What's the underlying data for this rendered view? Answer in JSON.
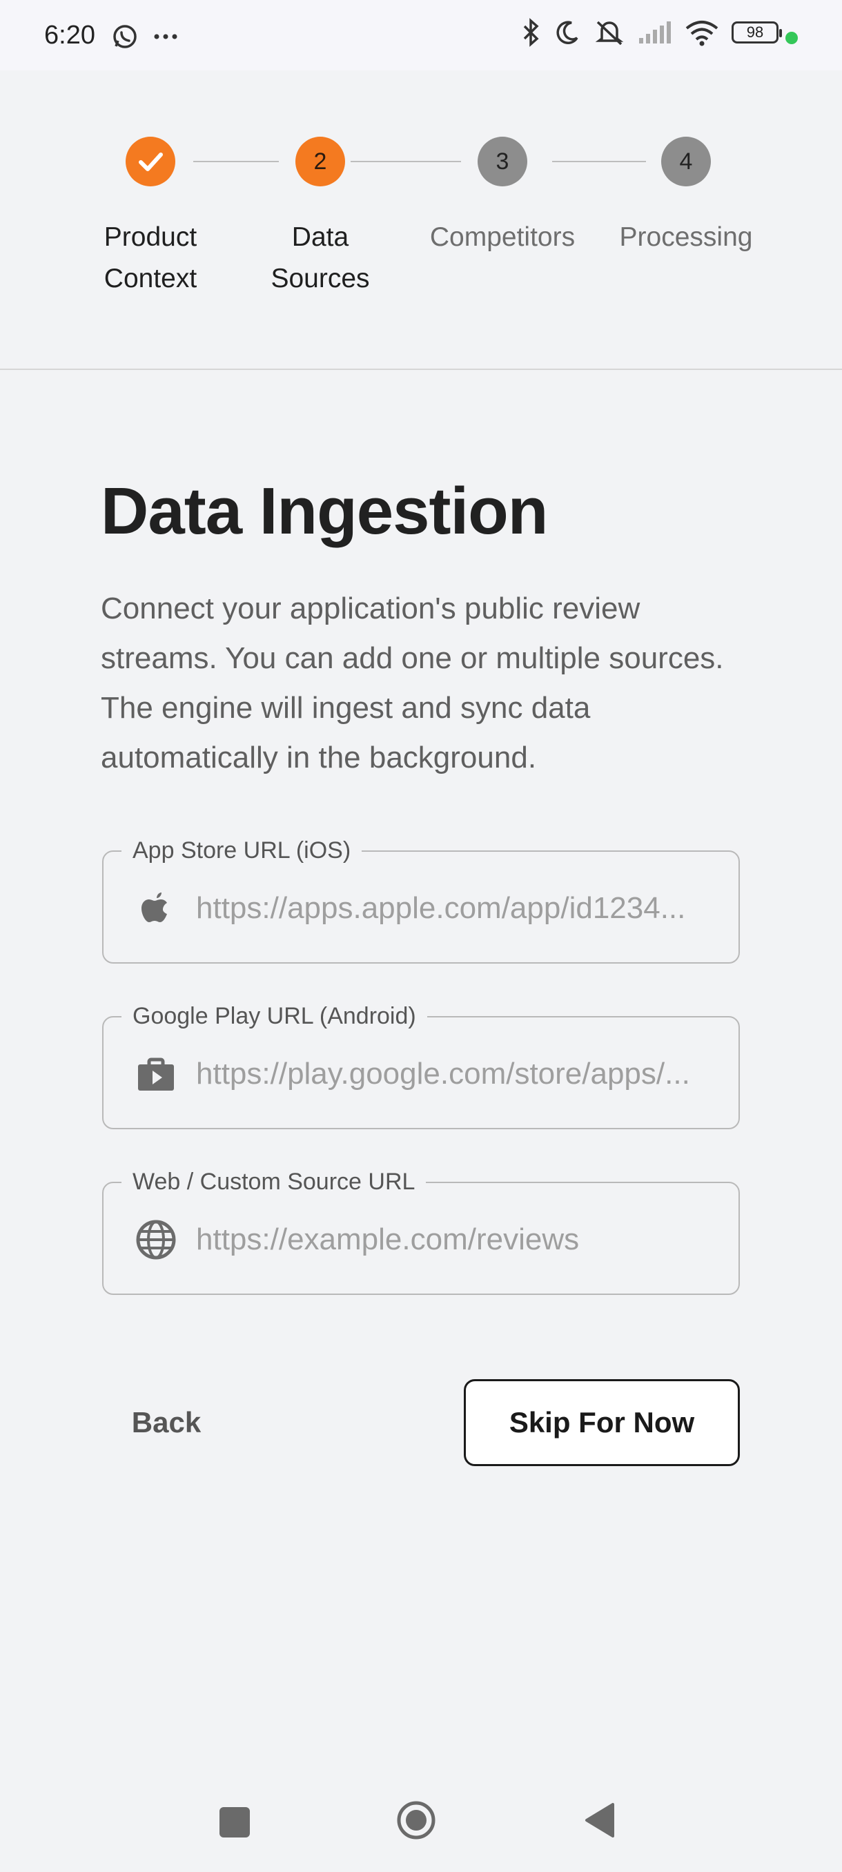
{
  "status_bar": {
    "time": "6:20",
    "battery": "98",
    "icons": [
      "whatsapp-icon",
      "more-icon",
      "bluetooth-icon",
      "moon-icon",
      "mute-icon",
      "signal-icon",
      "wifi-icon",
      "battery-icon"
    ]
  },
  "stepper": {
    "steps": [
      {
        "number": "1",
        "label_line1": "Product",
        "label_line2": "Context",
        "state": "done"
      },
      {
        "number": "2",
        "label_line1": "Data",
        "label_line2": "Sources",
        "state": "active"
      },
      {
        "number": "3",
        "label_line1": "Competitors",
        "label_line2": "",
        "state": "pending"
      },
      {
        "number": "4",
        "label_line1": "Processing",
        "label_line2": "",
        "state": "pending"
      }
    ]
  },
  "main": {
    "title": "Data Ingestion",
    "description": "Connect your application's public review streams. You can add one or multiple sources. The engine will ingest and sync data automatically in the background.",
    "fields": [
      {
        "label": "App Store URL (iOS)",
        "placeholder": "https://apps.apple.com/app/id1234...",
        "value": "",
        "icon": "apple-icon"
      },
      {
        "label": "Google Play URL (Android)",
        "placeholder": "https://play.google.com/store/apps/...",
        "value": "",
        "icon": "play-store-icon"
      },
      {
        "label": "Web / Custom Source URL",
        "placeholder": "https://example.com/reviews",
        "value": "",
        "icon": "globe-icon"
      }
    ]
  },
  "actions": {
    "back_label": "Back",
    "skip_label": "Skip For Now"
  },
  "colors": {
    "accent": "#f47a20",
    "pending": "#8d8d8d",
    "background": "#f2f3f5"
  }
}
